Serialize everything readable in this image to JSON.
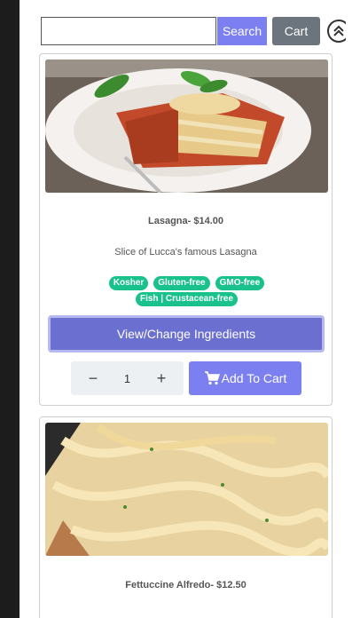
{
  "header": {
    "search_placeholder": "",
    "search_label": "Search",
    "cart_label": "Cart"
  },
  "items": [
    {
      "name": "Lasagna- $14.00",
      "description": "Slice of Lucca's famous Lasagna",
      "badges": [
        "Kosher",
        "Gluten-free",
        "GMO-free",
        "Fish | Crustacean-free"
      ],
      "view_label": "View/Change Ingredients",
      "quantity": "1",
      "minus": "−",
      "plus": "+",
      "add_label": "Add To Cart"
    },
    {
      "name": "Fettuccine Alfredo- $12.50"
    }
  ],
  "colors": {
    "primary": "#7b7ff0",
    "view_button": "#6a6fd0",
    "badge": "#19c28c",
    "cart": "#6c757d"
  }
}
